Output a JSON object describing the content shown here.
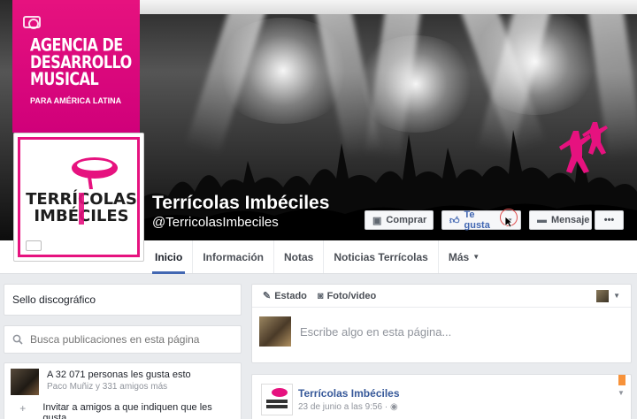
{
  "cover": {
    "agency_lines": [
      "AGENCIA DE",
      "DESARROLLO",
      "MUSICAL"
    ],
    "agency_sub": "PARA AMÉRICA LATINA",
    "logo_text_top": "TERRÍCOLAS",
    "logo_text_bottom": "IMBÉCILES"
  },
  "page": {
    "name": "Terrícolas Imbéciles",
    "handle": "@TerricolasImbeciles"
  },
  "actions": {
    "buy": "Comprar",
    "like": "Te gusta",
    "message": "Mensaje",
    "more": "•••"
  },
  "tabs": [
    {
      "label": "Inicio"
    },
    {
      "label": "Información"
    },
    {
      "label": "Notas"
    },
    {
      "label": "Noticias Terrícolas"
    },
    {
      "label": "Más"
    }
  ],
  "sidebar": {
    "label_card": "Sello discográfico",
    "search_placeholder": "Busca publicaciones en esta página",
    "likes_main": "A 32 071 personas les gusta esto",
    "likes_sub": "Paco Muñiz y 331 amigos más",
    "invite": "Invitar a amigos a que indiquen que les gusta"
  },
  "composer": {
    "status": "Estado",
    "photo": "Foto/video",
    "prompt": "Escribe algo en esta página..."
  },
  "post": {
    "author": "Terrícolas Imbéciles",
    "date": "23 de junio a las 9:56 · "
  },
  "colors": {
    "accent": "#4267b2",
    "brand_pink": "#e6127f",
    "link": "#365899"
  }
}
